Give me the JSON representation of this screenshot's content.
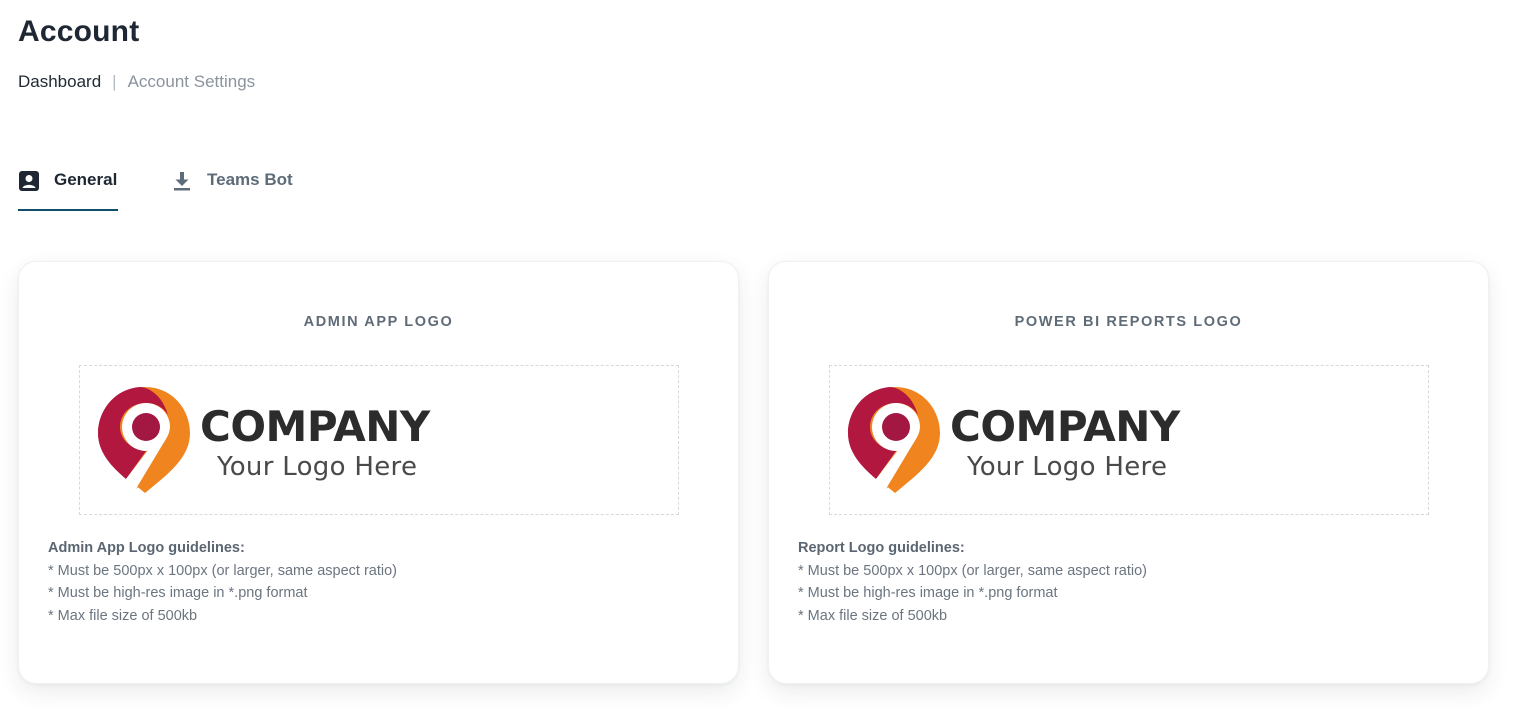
{
  "page": {
    "title": "Account"
  },
  "breadcrumb": {
    "items": [
      "Dashboard",
      "Account Settings"
    ],
    "separator": "|"
  },
  "tabs": [
    {
      "label": "General",
      "icon": "account-box-icon",
      "active": true
    },
    {
      "label": "Teams Bot",
      "icon": "download-icon",
      "active": false
    }
  ],
  "colors": {
    "tab_underline": "#0f4f6b",
    "logo_crimson": "#b1173f",
    "logo_orange": "#f0841f"
  },
  "cards": [
    {
      "heading": "ADMIN APP LOGO",
      "logo": {
        "company": "COMPANY",
        "tagline": "Your Logo Here"
      },
      "guidelines": {
        "title": "Admin App Logo guidelines:",
        "items": [
          "* Must be 500px x 100px (or larger, same aspect ratio)",
          "* Must be high-res image in *.png format",
          "* Max file size of 500kb"
        ]
      }
    },
    {
      "heading": "POWER BI REPORTS LOGO",
      "logo": {
        "company": "COMPANY",
        "tagline": "Your Logo Here"
      },
      "guidelines": {
        "title": "Report Logo guidelines:",
        "items": [
          "* Must be 500px x 100px (or larger, same aspect ratio)",
          "* Must be high-res image in *.png format",
          "* Max file size of 500kb"
        ]
      }
    }
  ]
}
